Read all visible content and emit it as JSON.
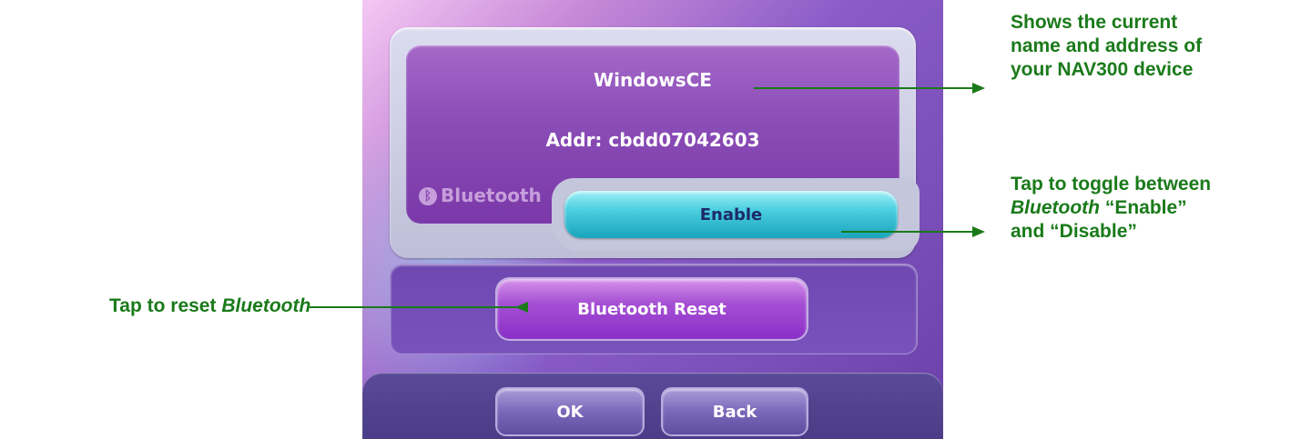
{
  "device_screen": {
    "device_name": "WindowsCE",
    "device_address": "Addr: cbdd07042603",
    "bluetooth_logo_text": "Bluetooth",
    "enable_toggle_label": "Enable",
    "reset_button_label": "Bluetooth Reset",
    "ok_button_label": "OK",
    "back_button_label": "Back"
  },
  "annotations": {
    "name_address": {
      "line1": "Shows the current",
      "line2": "name and address of",
      "line3": "your NAV300 device"
    },
    "toggle": {
      "line1": "Tap to toggle between",
      "line2_em": "Bluetooth",
      "line2_rest": " “Enable”",
      "line3": "and “Disable”"
    },
    "reset": {
      "text": "Tap to reset ",
      "em": "Bluetooth"
    }
  },
  "colors": {
    "annotation_green": "#1a7a1a",
    "panel_purple": "#8a4cb6",
    "enable_cyan": "#4ccfe0"
  }
}
